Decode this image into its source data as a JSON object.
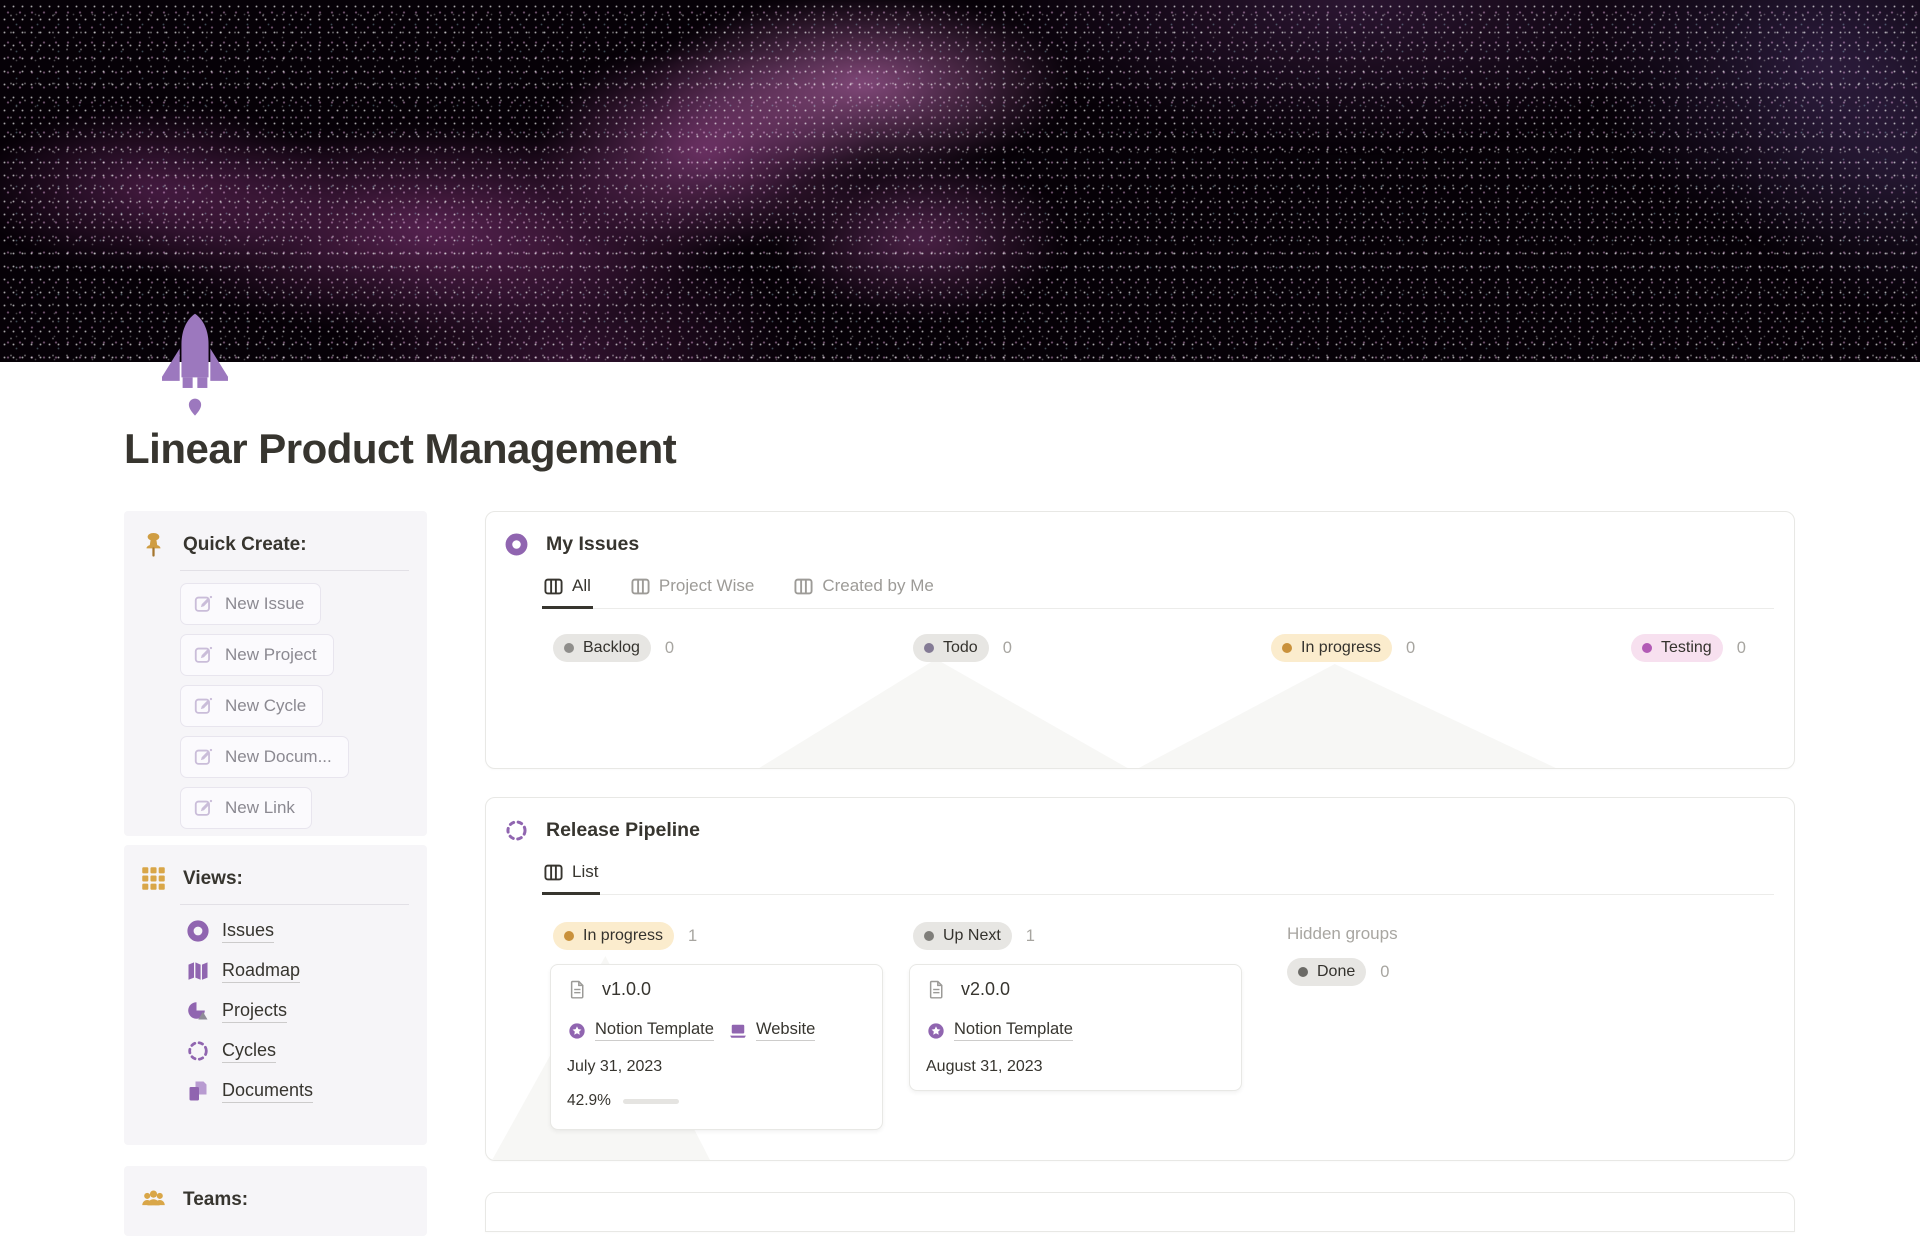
{
  "page": {
    "title": "Linear Product Management",
    "icon": "rocket-icon"
  },
  "colors": {
    "accent_purple": "#9065b0",
    "accent_gold": "#d9a648",
    "pill_gray_bg": "#e7e6e3",
    "pill_yellow_bg": "#fbeccd",
    "pill_pink_bg": "#f7e0ef",
    "text_dark": "#37352f",
    "text_gray": "#9d9b97"
  },
  "sidebar": {
    "quick_create": {
      "icon": "pushpin-icon",
      "heading": "Quick Create:",
      "buttons": [
        {
          "label": "New Issue"
        },
        {
          "label": "New Project"
        },
        {
          "label": "New Cycle"
        },
        {
          "label": "New Docum..."
        },
        {
          "label": "New Link"
        }
      ]
    },
    "views": {
      "icon": "grid-icon",
      "heading": "Views:",
      "items": [
        {
          "label": "Issues",
          "icon": "target-donut-icon"
        },
        {
          "label": "Roadmap",
          "icon": "map-icon"
        },
        {
          "label": "Projects",
          "icon": "shapes-icon"
        },
        {
          "label": "Cycles",
          "icon": "dashed-circle-icon"
        },
        {
          "label": "Documents",
          "icon": "pages-icon"
        }
      ]
    },
    "teams": {
      "icon": "people-icon",
      "heading": "Teams:"
    }
  },
  "my_issues": {
    "icon": "donut-icon",
    "title": "My Issues",
    "tabs": [
      {
        "label": "All",
        "active": true
      },
      {
        "label": "Project Wise",
        "active": false
      },
      {
        "label": "Created by Me",
        "active": false
      }
    ],
    "columns": [
      {
        "label": "Backlog",
        "count": "0",
        "color": "gray"
      },
      {
        "label": "Todo",
        "count": "0",
        "color": "gray"
      },
      {
        "label": "In progress",
        "count": "0",
        "color": "yellow"
      },
      {
        "label": "Testing",
        "count": "0",
        "color": "pink"
      }
    ]
  },
  "release_pipeline": {
    "icon": "dashed-circle-icon",
    "title": "Release Pipeline",
    "tabs": [
      {
        "label": "List",
        "active": true
      }
    ],
    "columns": [
      {
        "label": "In progress",
        "count": "1",
        "color": "yellow"
      },
      {
        "label": "Up Next",
        "count": "1",
        "color": "gray"
      }
    ],
    "hidden_groups_label": "Hidden groups",
    "hidden_column": {
      "label": "Done",
      "count": "0",
      "color": "gray"
    },
    "cards": [
      {
        "title": "v1.0.0",
        "links": [
          {
            "label": "Notion Template",
            "icon": "star-badge-icon"
          },
          {
            "label": "Website",
            "icon": "laptop-icon"
          }
        ],
        "date": "July 31, 2023",
        "progress_label": "42.9%",
        "progress_pct": 42.9
      },
      {
        "title": "v2.0.0",
        "links": [
          {
            "label": "Notion Template",
            "icon": "star-badge-icon"
          }
        ],
        "date": "August 31, 2023"
      }
    ]
  }
}
